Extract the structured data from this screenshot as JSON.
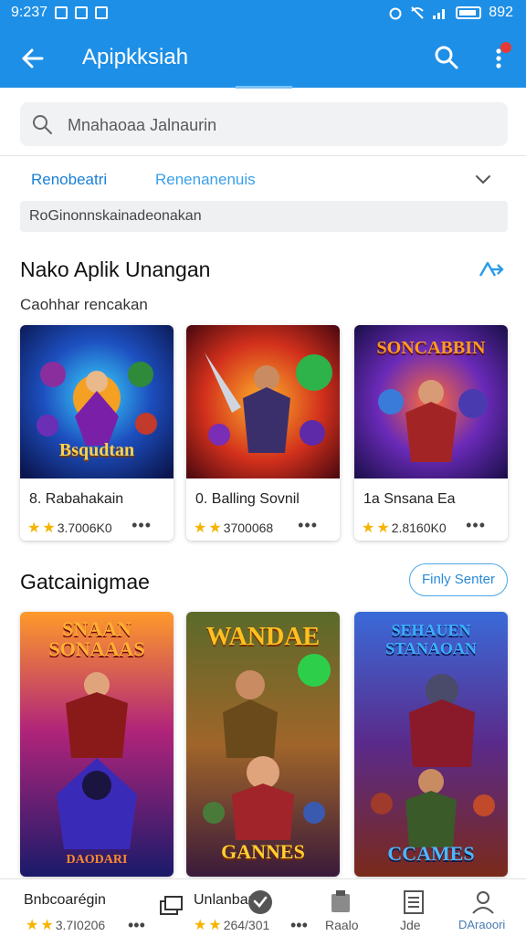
{
  "status_bar": {
    "time": "9:237",
    "right_text": "892"
  },
  "app_bar": {
    "title": "Apipkksiah"
  },
  "search": {
    "placeholder": "Mnahaoaa Jalnaurin"
  },
  "tabs": [
    {
      "label": "Renobeatri"
    },
    {
      "label": "Renenanenuis"
    }
  ],
  "filter": {
    "label": "RoGinonnskainadeonakan"
  },
  "section1": {
    "title": "Nako Aplik Unangan",
    "subtitle": "Caohhar rencakan",
    "cards": [
      {
        "art_title": "Bsqudtan",
        "name": "8. Rabahakain",
        "rating": "3.7006K0"
      },
      {
        "art_title": "",
        "name": "0. Balling Sovnil",
        "rating": "3700068"
      },
      {
        "art_title": "SONCABBIN",
        "name": "1a Snsana Ea",
        "rating": "2.8160K0"
      }
    ]
  },
  "section2": {
    "title": "Gatcainigmae",
    "button": "Finly Senter",
    "cards": [
      {
        "art_title": "SNAAN SONAAAS",
        "art_bottom": "DAODARI"
      },
      {
        "art_title": "WANDAE",
        "art_bottom": "GANNES"
      },
      {
        "art_title": "SEHAUEN STANAOAN",
        "art_bottom": "CCAMES"
      }
    ]
  },
  "bottom_nav": {
    "left_title": "Bnbcoarégin",
    "left_rating": "3.7I0206",
    "item2_label": "Unlanbar",
    "item2_rating": "264/301",
    "item3_label": "Raalo",
    "item4_label": "Jde",
    "item5_label": "DAraoori"
  },
  "colors": {
    "primary": "#1e8fe6",
    "star": "#f5b400",
    "accent_blue": "#2a8ad8"
  }
}
